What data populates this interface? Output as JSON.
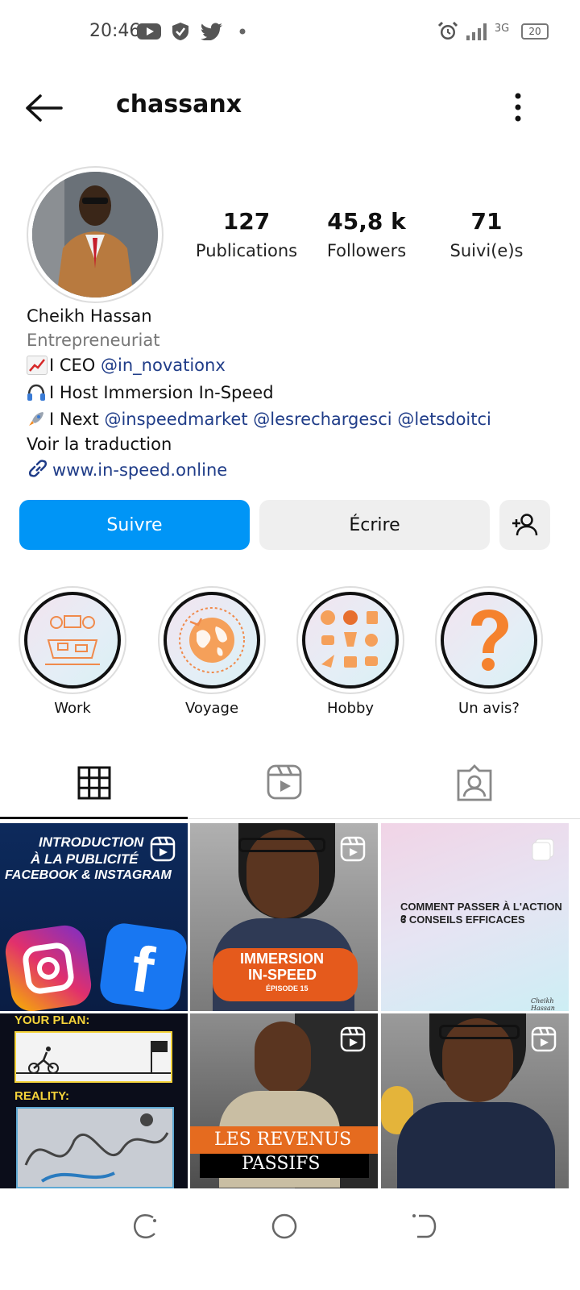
{
  "status_bar": {
    "time": "20:46",
    "network": "3G",
    "battery": "20",
    "icons": [
      "youtube-icon",
      "shield-icon",
      "twitter-icon",
      "dot-icon",
      "alarm-icon",
      "signal-icon",
      "battery-icon"
    ]
  },
  "header": {
    "username": "chassanx",
    "back_icon": "back-arrow-icon",
    "menu_icon": "more-vertical-icon"
  },
  "profile": {
    "stats": [
      {
        "value": "127",
        "label": "Publications"
      },
      {
        "value": "45,8 k",
        "label": "Followers"
      },
      {
        "value": "71",
        "label": "Suivi(e)s"
      }
    ],
    "name": "Cheikh Hassan",
    "category": "Entrepreneuriat",
    "bio_lines": [
      {
        "emoji": "chart-emoji",
        "text": "I CEO ",
        "mentions": [
          "@in_novationx"
        ]
      },
      {
        "emoji": "headphones-emoji",
        "text": "I Host Immersion In-Speed",
        "mentions": []
      },
      {
        "emoji": "rocket-emoji",
        "text": "I Next ",
        "mentions": [
          "@inspeedmarket",
          "@lesrechargesci",
          "@letsdoitci"
        ]
      }
    ],
    "translate": "Voir la traduction",
    "website": "www.in-speed.online"
  },
  "actions": {
    "follow": "Suivre",
    "message": "Écrire"
  },
  "highlights": [
    {
      "label": "Work"
    },
    {
      "label": "Voyage"
    },
    {
      "label": "Hobby"
    },
    {
      "label": "Un avis?"
    }
  ],
  "posts": [
    {
      "lines": [
        "INTRODUCTION",
        "À LA PUBLICITÉ",
        "FACEBOOK & INSTAGRAM"
      ],
      "type": "reel"
    },
    {
      "lines": [
        "IMMERSION",
        "IN-SPEED",
        "ÉPISODE 15"
      ],
      "type": "reel"
    },
    {
      "lines": [
        "COMMENT PASSER À L'ACTION ?",
        "6 CONSEILS EFFICACES",
        "Cheikh Hassan"
      ],
      "type": "carousel"
    },
    {
      "lines": [
        "YOUR PLAN:",
        "REALITY:"
      ],
      "type": "image"
    },
    {
      "lines": [
        "LES REVENUS",
        "PASSIFS"
      ],
      "type": "reel"
    },
    {
      "lines": [],
      "type": "reel"
    }
  ],
  "colors": {
    "accent": "#0095f6",
    "link": "#1f3c88",
    "secondary_button": "#efefef"
  }
}
